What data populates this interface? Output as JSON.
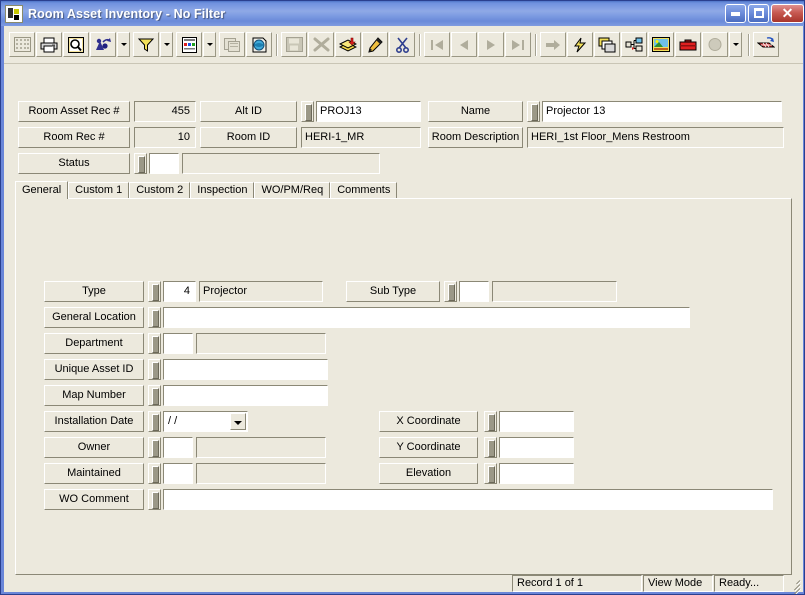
{
  "window": {
    "title": "Room Asset Inventory - No Filter",
    "icon": "app-icon",
    "minimize_label": "",
    "maximize_label": "",
    "close_label": "✕"
  },
  "toolbar": {
    "items": [
      {
        "name": "grid-view-icon",
        "enabled": false
      },
      {
        "name": "print-icon",
        "enabled": true
      },
      {
        "name": "print-preview-icon",
        "enabled": true
      },
      {
        "name": "find-icon",
        "enabled": true,
        "dropdown": true
      },
      {
        "name": "filter-funnel-icon",
        "enabled": true,
        "dropdown": true
      },
      {
        "name": "report-icon",
        "enabled": true,
        "dropdown": true
      },
      {
        "name": "copy-record-icon",
        "enabled": false
      },
      {
        "name": "refresh-globe-icon",
        "enabled": true
      },
      {
        "name": "save-icon",
        "enabled": false
      },
      {
        "name": "delete-record-icon",
        "enabled": false
      },
      {
        "name": "add-record-icon",
        "enabled": true
      },
      {
        "name": "edit-pencil-icon",
        "enabled": true
      },
      {
        "name": "cut-scissors-icon",
        "enabled": true
      },
      {
        "name": "first-record-icon",
        "enabled": false
      },
      {
        "name": "previous-record-icon",
        "enabled": false
      },
      {
        "name": "next-record-icon",
        "enabled": false
      },
      {
        "name": "last-record-icon",
        "enabled": false
      },
      {
        "name": "goto-record-icon",
        "enabled": false
      },
      {
        "name": "quick-action-icon",
        "enabled": true
      },
      {
        "name": "windows-cascade-icon",
        "enabled": true
      },
      {
        "name": "hierarchy-tree-icon",
        "enabled": true
      },
      {
        "name": "image-view-icon",
        "enabled": true
      },
      {
        "name": "toolbox-icon",
        "enabled": true
      },
      {
        "name": "help-icon",
        "enabled": false,
        "dropdown": true
      },
      {
        "name": "export-table-icon",
        "enabled": true
      }
    ]
  },
  "header": {
    "room_asset_rec_label": "Room Asset Rec #",
    "room_asset_rec_value": "455",
    "alt_id_label": "Alt ID",
    "alt_id_value": "PROJ13",
    "name_label": "Name",
    "name_value": "Projector 13",
    "room_rec_label": "Room Rec #",
    "room_rec_value": "10",
    "room_id_label": "Room ID",
    "room_id_value": "HERI-1_MR",
    "room_description_label": "Room Description",
    "room_description_value": "HERI_1st Floor_Mens Restroom",
    "status_label": "Status",
    "status_code_value": "",
    "status_desc_value": ""
  },
  "tabs": [
    {
      "label": "General",
      "selected": true
    },
    {
      "label": "Custom 1",
      "selected": false
    },
    {
      "label": "Custom 2",
      "selected": false
    },
    {
      "label": "Inspection",
      "selected": false
    },
    {
      "label": "WO/PM/Req",
      "selected": false
    },
    {
      "label": "Comments",
      "selected": false
    }
  ],
  "general": {
    "type_label": "Type",
    "type_code_value": "4",
    "type_desc_value": "Projector",
    "sub_type_label": "Sub Type",
    "sub_type_code_value": "",
    "sub_type_desc_value": "",
    "general_location_label": "General Location",
    "general_location_value": "",
    "department_label": "Department",
    "department_code_value": "",
    "department_desc_value": "",
    "unique_asset_id_label": "Unique Asset ID",
    "unique_asset_id_value": "",
    "map_number_label": "Map Number",
    "map_number_value": "",
    "installation_date_label": "Installation Date",
    "installation_date_value": "  /  /",
    "owner_label": "Owner",
    "owner_code_value": "",
    "owner_desc_value": "",
    "maintained_label": "Maintained",
    "maintained_code_value": "",
    "maintained_desc_value": "",
    "wo_comment_label": "WO Comment",
    "wo_comment_value": "",
    "x_coordinate_label": "X Coordinate",
    "x_coordinate_value": "",
    "y_coordinate_label": "Y Coordinate",
    "y_coordinate_value": "",
    "elevation_label": "Elevation",
    "elevation_value": ""
  },
  "statusbar": {
    "record": "Record 1 of 1",
    "mode": "View Mode",
    "state": "Ready..."
  },
  "colors": {
    "face": "#ece9dd",
    "field_readonly": "#ece9dd",
    "field_editable": "#ffffff",
    "title_blue": "#6f91de",
    "border_dark": "#8b8876",
    "close_red": "#c75a52"
  }
}
